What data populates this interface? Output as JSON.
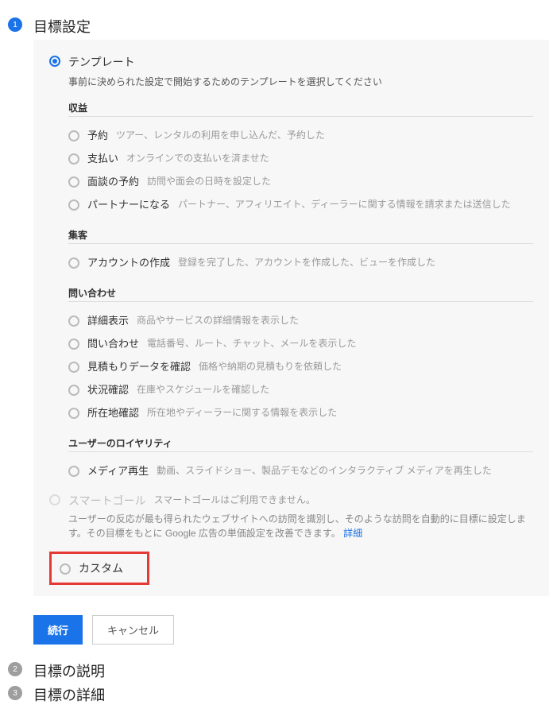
{
  "steps": {
    "s1": {
      "num": "1",
      "title": "目標設定"
    },
    "s2": {
      "num": "2",
      "title": "目標の説明"
    },
    "s3": {
      "num": "3",
      "title": "目標の詳細"
    }
  },
  "template": {
    "label": "テンプレート",
    "desc": "事前に決められた設定で開始するためのテンプレートを選択してください"
  },
  "cats": [
    {
      "title": "収益",
      "items": [
        {
          "label": "予約",
          "desc": "ツアー、レンタルの利用を申し込んだ、予約した"
        },
        {
          "label": "支払い",
          "desc": "オンラインでの支払いを済ませた"
        },
        {
          "label": "面談の予約",
          "desc": "訪問や面会の日時を設定した"
        },
        {
          "label": "パートナーになる",
          "desc": "パートナー、アフィリエイト、ディーラーに関する情報を請求または送信した"
        }
      ]
    },
    {
      "title": "集客",
      "items": [
        {
          "label": "アカウントの作成",
          "desc": "登録を完了した、アカウントを作成した、ビューを作成した"
        }
      ]
    },
    {
      "title": "問い合わせ",
      "items": [
        {
          "label": "詳細表示",
          "desc": "商品やサービスの詳細情報を表示した"
        },
        {
          "label": "問い合わせ",
          "desc": "電話番号、ルート、チャット、メールを表示した"
        },
        {
          "label": "見積もりデータを確認",
          "desc": "価格や納期の見積もりを依頼した"
        },
        {
          "label": "状況確認",
          "desc": "在庫やスケジュールを確認した"
        },
        {
          "label": "所在地確認",
          "desc": "所在地やディーラーに関する情報を表示した"
        }
      ]
    },
    {
      "title": "ユーザーのロイヤリティ",
      "items": [
        {
          "label": "メディア再生",
          "desc": "動画、スライドショー、製品デモなどのインタラクティブ メディアを再生した"
        }
      ]
    }
  ],
  "smart": {
    "label": "スマートゴール",
    "note": "スマートゴールはご利用できません。",
    "desc": "ユーザーの反応が最も得られたウェブサイトへの訪問を識別し、そのような訪問を自動的に目標に設定します。その目標をもとに Google 広告の単価設定を改善できます。",
    "link": "詳細"
  },
  "custom": {
    "label": "カスタム"
  },
  "buttons": {
    "continue": "続行",
    "cancel": "キャンセル"
  }
}
